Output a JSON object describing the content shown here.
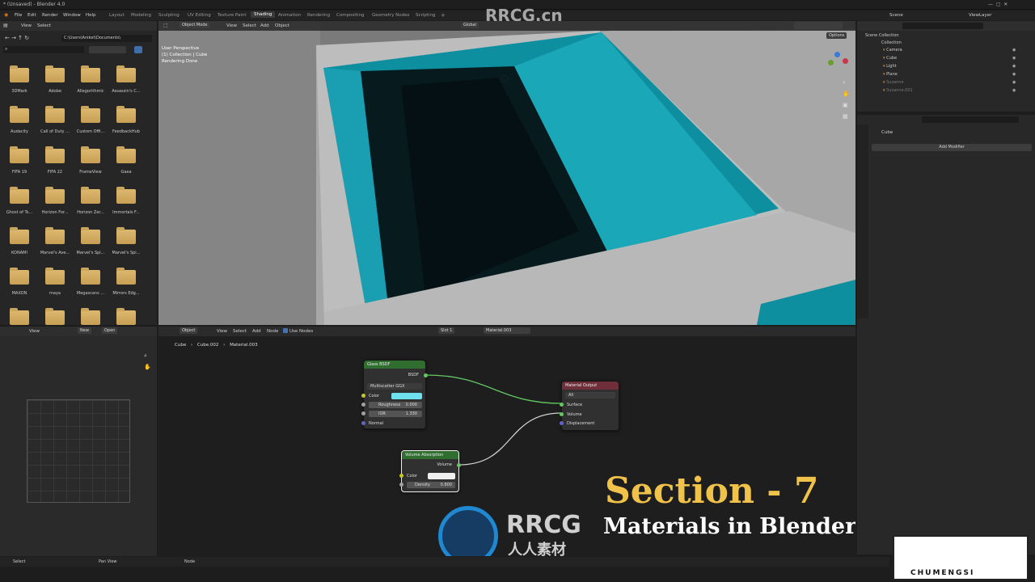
{
  "window_title": "* (Unsaved) - Blender 4.0",
  "menu": [
    "File",
    "Edit",
    "Render",
    "Window",
    "Help"
  ],
  "workspaces": [
    "Layout",
    "Modeling",
    "Sculpting",
    "UV Editing",
    "Texture Paint",
    "Shading",
    "Animation",
    "Rendering",
    "Compositing",
    "Geometry Nodes",
    "Scripting",
    "+"
  ],
  "active_workspace": "Shading",
  "top_right": {
    "scene": "Scene",
    "view_layer": "ViewLayer"
  },
  "file_browser": {
    "menu": [
      "View",
      "Select"
    ],
    "path": "C:\\Users\\Aniket\\Documents\\",
    "folders": [
      "3DMark",
      "Adobe",
      "Allegorithmic",
      "Assassin's C...",
      "Audacity",
      "Call of Duty ...",
      "Custom Offi...",
      "FeedbackHub",
      "FIFA 19",
      "FIFA 22",
      "FrameView",
      "Gaea",
      "Ghost of Ts...",
      "Horizon For...",
      "Horizon Zer...",
      "Immortals F...",
      "KONAMI",
      "Marvel's Ave...",
      "Marvel's Spi...",
      "Marvel's Spi...",
      "MAXON",
      "maya",
      "Megascans ...",
      "Mirrors Edg...",
      "",
      "",
      "",
      ""
    ]
  },
  "viewport": {
    "mode": "Object Mode",
    "menu": [
      "View",
      "Select",
      "Add",
      "Object"
    ],
    "transform": "Global",
    "options": "Options",
    "info": [
      "User Perspective",
      "(1) Collection | Cube",
      "Rendering Done"
    ]
  },
  "outliner": {
    "root": "Scene Collection",
    "collection": "Collection",
    "items": [
      "Camera",
      "Cube",
      "Light",
      "Plane",
      "Suzanne",
      "Suzanne.001"
    ]
  },
  "properties": {
    "object": "Cube",
    "add_modifier": "Add Modifier"
  },
  "image_editor": {
    "menu": [
      "View"
    ],
    "new": "New",
    "open": "Open"
  },
  "node_editor": {
    "mode": "Object",
    "menu": [
      "View",
      "Select",
      "Add",
      "Node"
    ],
    "use_nodes": "Use Nodes",
    "slot": "Slot 1",
    "material": "Material.003",
    "breadcrumb": [
      "Cube",
      "Cube.002",
      "Material.003"
    ],
    "glass": {
      "title": "Glass BSDF",
      "out": "BSDF",
      "dist": "Multiscatter GGX",
      "color": "Color",
      "rough_label": "Roughness",
      "rough": "0.000",
      "ior_label": "IOR",
      "ior": "1.330",
      "normal": "Normal",
      "color_hex": "#6fe0ee"
    },
    "output": {
      "title": "Material Output",
      "target": "All",
      "surface": "Surface",
      "volume": "Volume",
      "displacement": "Displacement"
    },
    "absorption": {
      "title": "Volume Absorption",
      "out": "Volume",
      "color": "Color",
      "density_label": "Density",
      "density": "0.800"
    }
  },
  "overlay": {
    "section": "Section - 7",
    "subtitle": "Materials in Blender",
    "brand": "RRCG",
    "brand_cn": "人人素材",
    "watermark": "RRCG.cn",
    "corner_brand": "CHUMENGSI"
  },
  "status": [
    "Select",
    "Pan View",
    "Node"
  ]
}
